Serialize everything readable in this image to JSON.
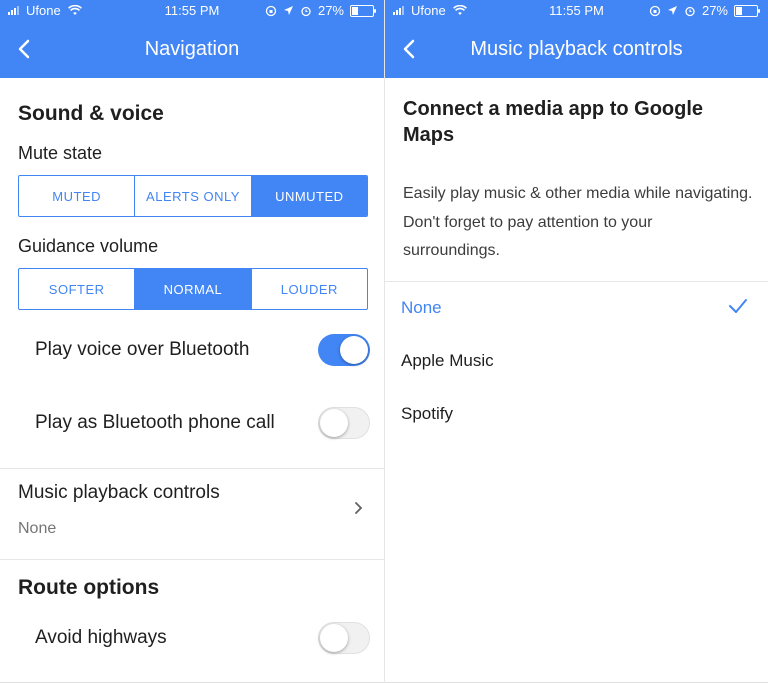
{
  "status_left": {
    "carrier": "Ufone",
    "time": "11:55 PM",
    "battery": "27%"
  },
  "status_right": {
    "carrier": "Ufone",
    "time": "11:55 PM",
    "battery": "27%"
  },
  "left_panel": {
    "title": "Navigation",
    "sound_section": "Sound & voice",
    "mute_label": "Mute state",
    "mute_options": [
      "MUTED",
      "ALERTS ONLY",
      "UNMUTED"
    ],
    "mute_selected": "UNMUTED",
    "volume_label": "Guidance volume",
    "volume_options": [
      "SOFTER",
      "NORMAL",
      "LOUDER"
    ],
    "volume_selected": "NORMAL",
    "toggles": [
      {
        "label": "Play voice over Bluetooth",
        "on": true
      },
      {
        "label": "Play as Bluetooth phone call",
        "on": false
      }
    ],
    "music_row": {
      "title": "Music playback controls",
      "value": "None"
    },
    "route_section": "Route options",
    "avoid_highways": {
      "label": "Avoid highways",
      "on": false
    }
  },
  "right_panel": {
    "title": "Music playback controls",
    "heading": "Connect a media app to Google Maps",
    "description": "Easily play music & other media while navigating. Don't forget to pay attention to your surroundings.",
    "options": [
      {
        "name": "None",
        "selected": true
      },
      {
        "name": "Apple Music",
        "selected": false
      },
      {
        "name": "Spotify",
        "selected": false
      }
    ]
  },
  "colors": {
    "accent": "#4285f4",
    "text": "#1f1f1f",
    "muted": "#757575"
  },
  "icons": [
    "back-arrow-icon",
    "chevron-right-icon",
    "checkmark-icon",
    "wifi-icon",
    "location-arrow-icon",
    "alarm-icon",
    "orientation-lock-icon"
  ]
}
